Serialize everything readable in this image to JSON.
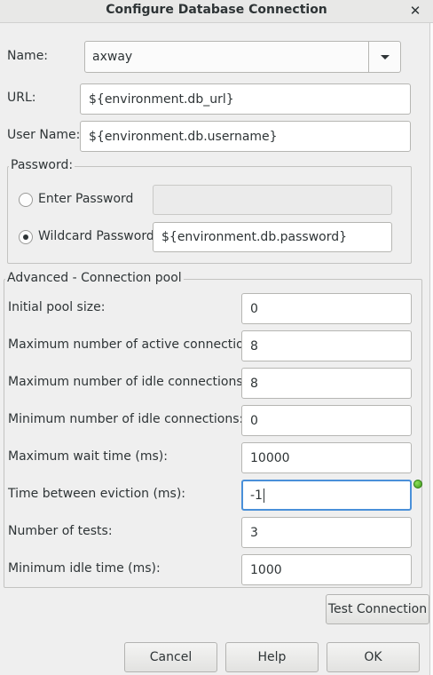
{
  "window": {
    "title": "Configure Database Connection"
  },
  "name": {
    "label": "Name:",
    "value": "axway"
  },
  "url": {
    "label": "URL:",
    "value": "${environment.db_url}"
  },
  "username": {
    "label": "User Name:",
    "value": "${environment.db.username}"
  },
  "password": {
    "group_label": "Password:",
    "enter_label": "Enter Password",
    "enter_value": "",
    "wildcard_label": "Wildcard Password",
    "wildcard_value": "${environment.db.password}",
    "selected": "wildcard"
  },
  "advanced": {
    "group_label": "Advanced - Connection pool",
    "fields": [
      {
        "label": "Initial pool size:",
        "value": "0"
      },
      {
        "label": "Maximum number of active connections:",
        "value": "8"
      },
      {
        "label": "Maximum number of idle connections:",
        "value": "8"
      },
      {
        "label": "Minimum number of idle connections:",
        "value": "0"
      },
      {
        "label": "Maximum wait time (ms):",
        "value": "10000"
      },
      {
        "label": "Time between eviction (ms):",
        "value": "-1"
      },
      {
        "label": "Number of tests:",
        "value": "3"
      },
      {
        "label": "Minimum idle time (ms):",
        "value": "1000"
      }
    ]
  },
  "buttons": {
    "test_connection": "Test Connection",
    "cancel": "Cancel",
    "help": "Help",
    "ok": "OK"
  },
  "icons": {
    "close": "close-icon",
    "dropdown": "chevron-down-icon",
    "status": "valid-status-icon"
  },
  "colors": {
    "focus_border": "#4a90d9",
    "status_green": "#3e9a1c"
  }
}
